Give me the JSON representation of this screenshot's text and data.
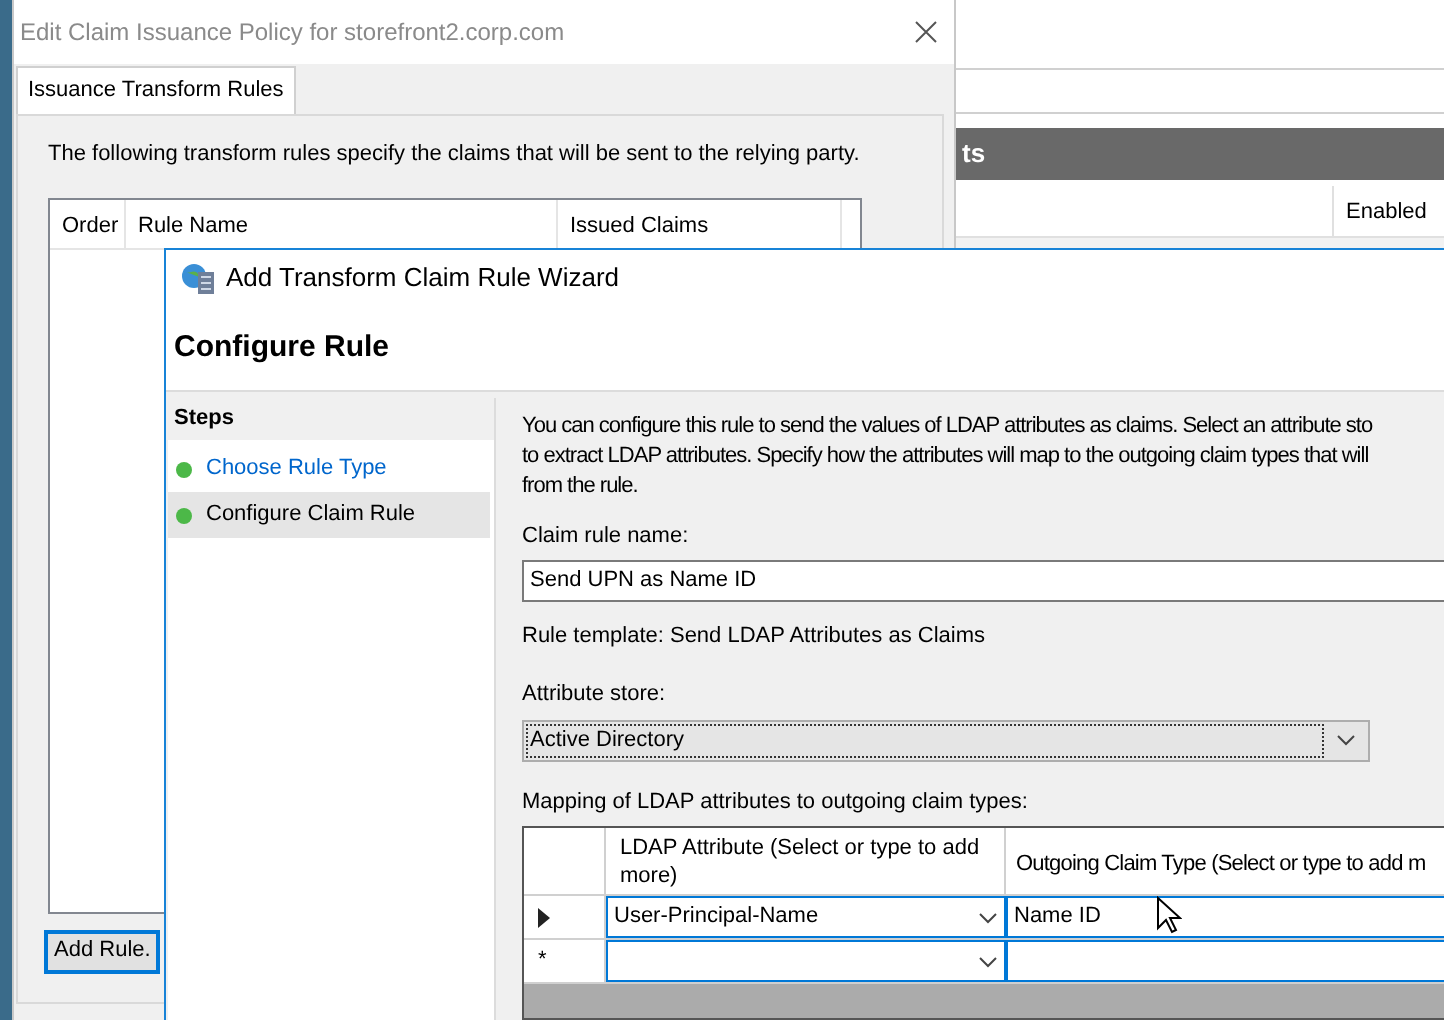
{
  "background_window": {
    "header": "ts",
    "columns": [
      "Enabled"
    ]
  },
  "policy_dialog": {
    "title": "Edit Claim Issuance Policy for storefront2.corp.com",
    "tabs": [
      {
        "label": "Issuance Transform Rules",
        "selected": true
      }
    ],
    "description": "The following transform rules specify the claims that will be sent to the relying party.",
    "rules_table": {
      "columns": [
        "Order",
        "Rule Name",
        "Issued Claims"
      ]
    },
    "buttons": [
      "Add Rule."
    ]
  },
  "wizard": {
    "title": "Add Transform Claim Rule Wizard",
    "heading": "Configure Rule",
    "steps_title": "Steps",
    "steps": [
      {
        "label": "Choose Rule Type",
        "selected": false
      },
      {
        "label": "Configure Claim Rule",
        "selected": true
      }
    ],
    "description_lines": [
      "You can configure this rule to send the values of LDAP attributes as claims. Select an attribute sto",
      "to extract LDAP attributes. Specify how the attributes will map to the outgoing claim types that will",
      "from the rule."
    ],
    "claim_rule_name": {
      "label": "Claim rule name:",
      "value": "Send UPN as Name ID"
    },
    "rule_template": "Rule template: Send LDAP Attributes as Claims",
    "attribute_store": {
      "label": "Attribute store:",
      "value": "Active Directory"
    },
    "mapping": {
      "label": "Mapping of LDAP attributes to outgoing claim types:",
      "columns": [
        "LDAP Attribute (Select or type to add more)",
        "Outgoing Claim Type (Select or type to add m"
      ],
      "rows": [
        {
          "kind": "current",
          "ldap_attribute": "User-Principal-Name",
          "claim_type": "Name ID"
        },
        {
          "kind": "new",
          "marker": "*"
        }
      ]
    }
  }
}
